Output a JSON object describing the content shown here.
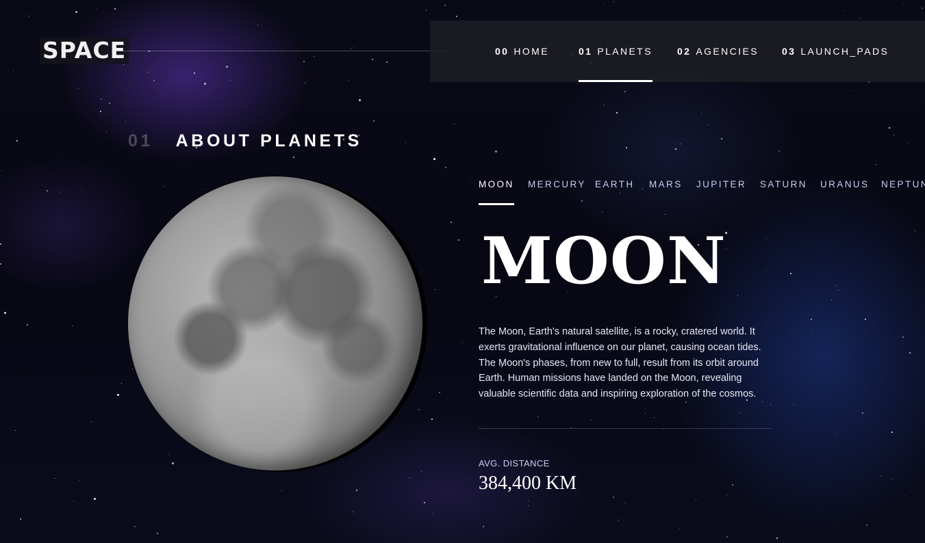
{
  "logo": {
    "text": "SPACE"
  },
  "nav": {
    "items": [
      {
        "num": "00",
        "label": "HOME",
        "active": false
      },
      {
        "num": "01",
        "label": "PLANETS",
        "active": true
      },
      {
        "num": "02",
        "label": "AGENCIES",
        "active": false
      },
      {
        "num": "03",
        "label": "LAUNCH_PADS",
        "active": false
      }
    ]
  },
  "section": {
    "num": "01",
    "title": "ABOUT PLANETS"
  },
  "planets": {
    "tabs": [
      "MOON",
      "MERCURY",
      "EARTH",
      "MARS",
      "JUPITER",
      "SATURN",
      "URANUS",
      "NEPTUNE"
    ],
    "active": "MOON"
  },
  "planet": {
    "name": "MOON",
    "description": "The Moon, Earth's natural satellite, is a rocky, cratered world. It exerts gravitational influence on our planet, causing ocean tides. The Moon's phases, from new to full, result from its orbit around Earth. Human missions have landed on the Moon, revealing valuable scientific data and inspiring exploration of the cosmos.",
    "stat_label": "AVG. DISTANCE",
    "stat_value": "384,400 KM"
  }
}
